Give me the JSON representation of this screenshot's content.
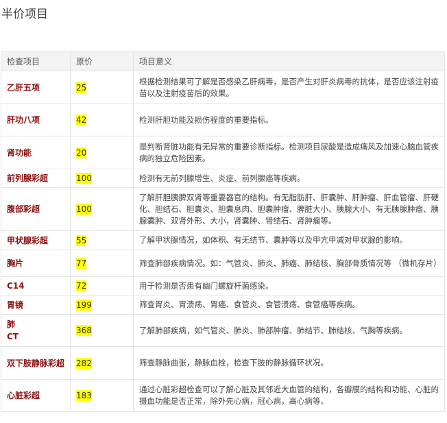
{
  "page": {
    "title": "半价项目"
  },
  "table": {
    "headers": [
      "检查项目",
      "原价",
      "项目意义"
    ],
    "rows": [
      {
        "name": "乙肝五项",
        "price": "25",
        "desc": "根据检测结果可了解是否感染乙肝病毒，是否产生对肝炎病毒的抗体，是否应该注射疫苗以及注射疫苗后的效果。"
      },
      {
        "name": "肝功八项",
        "price": "42",
        "desc": " 检测肝胆功能及损伤程度的重要指标。"
      },
      {
        "name": "肾功能",
        "price": "20",
        "desc": "是判断肾脏功能有无异常的重要诊断指标。检测项目尿酸是造成痛风及加速心脑血管疾病的独立危险因素。"
      },
      {
        "name": "前列腺彩超",
        "price": "100",
        "desc": "检测有无前列腺增生、炎症、前列腺癌等疾病。"
      },
      {
        "name": "腹部彩超",
        "price": "100",
        "desc": "了解肝胆胰脾双肾等重要器官的结构。有无脂肪肝、肝囊肿、肝肿瘤、肝血管瘤、肝硬化、胆结石、胆囊炎、胆囊息肉、胆囊肿瘤、脾脏大小、胰腺大小、有无胰腺肿瘤、胰腺囊肿、双肾外形、大小，肾囊肿、肾结石、肾肿瘤等。"
      },
      {
        "name": "甲状腺彩超",
        "price": "55",
        "desc": "了解甲状腺情况，如体积、有无结节、囊肿等以及甲亢甲减对甲状腺的影响。"
      },
      {
        "name": "胸片",
        "price": "77",
        "desc": "筛查肺部疾病情况。如：气管炎、肺炎、肺癌、肺结核、胸部骨质情况等 （微机存片）"
      },
      {
        "name": "C14",
        "price": "72",
        "desc": "用于检测是否患有幽门螺旋杆菌感染。"
      },
      {
        "name": "胃镜",
        "price": "199",
        "desc": "筛查胃炎、胃溃疡、胃癌、食管炎、食管溃疡、食管癌等疾病。"
      },
      {
        "name": "肺\nCT",
        "price": "368",
        "desc": "了解肺部疾病，如气管炎、肺炎、肺部肿瘤、肺结节、肺结核、气胸等疾病。"
      },
      {
        "name": "双下肢静脉彩超",
        "price": "282",
        "desc": "筛查静脉曲张，静脉血栓，检查下肢的静脉循环状况。"
      },
      {
        "name": "心脏彩超",
        "price": "183",
        "desc": "通过心脏彩超检查可以了解心脏及其邻近大血管的结构，各瓣膜的结构和功能、心脏的摄血功能是否正常，除外先心病，冠心病，高心病等。"
      }
    ]
  }
}
